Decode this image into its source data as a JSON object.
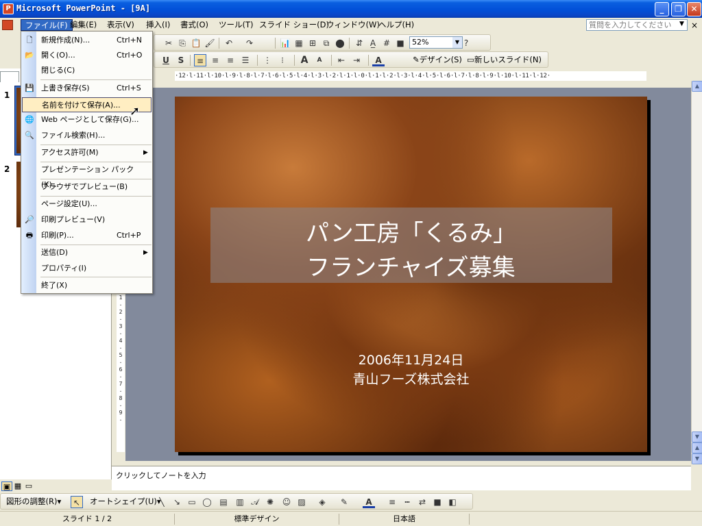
{
  "window": {
    "title": "Microsoft PowerPoint - [9A]",
    "app_icon_letter": "P",
    "minimize_glyph": "_",
    "restore_glyph": "❐",
    "close_glyph": "✕"
  },
  "menubar": {
    "items": [
      "ファイル(F)",
      "編集(E)",
      "表示(V)",
      "挿入(I)",
      "書式(O)",
      "ツール(T)",
      "スライド ショー(D)",
      "ウィンドウ(W)",
      "ヘルプ(H)"
    ],
    "active_index": 0,
    "ask_placeholder": "質問を入力してください",
    "ask_dropdown": "▼",
    "close_glyph": "×"
  },
  "toolbar": {
    "zoom": "52%",
    "zoom_dropdown": "▼",
    "design_label": "デザイン(S)",
    "new_slide_label": "新しいスライド(N)",
    "bold_glyph": "U",
    "shadow_glyph": "S",
    "font_grow": "A",
    "font_shrink": "A",
    "font_color": "A",
    "help_glyph": "?"
  },
  "file_menu": {
    "items": [
      {
        "label": "新規作成(N)...",
        "shortcut": "Ctrl+N",
        "icon": "new-doc-icon",
        "glyph": "🗋"
      },
      {
        "label": "開く(O)...",
        "shortcut": "Ctrl+O",
        "icon": "open-folder-icon",
        "glyph": "📂"
      },
      {
        "label": "閉じる(C)",
        "shortcut": "",
        "icon": "",
        "glyph": ""
      },
      {
        "label": "上書き保存(S)",
        "shortcut": "Ctrl+S",
        "icon": "save-icon",
        "glyph": "💾"
      },
      {
        "label": "名前を付けて保存(A)...",
        "shortcut": "",
        "icon": "",
        "glyph": ""
      },
      {
        "label": "Web ページとして保存(G)...",
        "shortcut": "",
        "icon": "web-save-icon",
        "glyph": "🌐"
      },
      {
        "label": "ファイル検索(H)...",
        "shortcut": "",
        "icon": "file-search-icon",
        "glyph": "🔍"
      },
      {
        "label": "アクセス許可(M)",
        "shortcut": "",
        "icon": "",
        "glyph": ""
      },
      {
        "label": "プレゼンテーション パック(K)...",
        "shortcut": "",
        "icon": "",
        "glyph": ""
      },
      {
        "label": "ブラウザでプレビュー(B)",
        "shortcut": "",
        "icon": "",
        "glyph": ""
      },
      {
        "label": "ページ設定(U)...",
        "shortcut": "",
        "icon": "",
        "glyph": ""
      },
      {
        "label": "印刷プレビュー(V)",
        "shortcut": "",
        "icon": "print-preview-icon",
        "glyph": "🔎"
      },
      {
        "label": "印刷(P)...",
        "shortcut": "Ctrl+P",
        "icon": "print-icon",
        "glyph": "🖶"
      },
      {
        "label": "送信(D)",
        "shortcut": "",
        "icon": "",
        "glyph": ""
      },
      {
        "label": "プロパティ(I)",
        "shortcut": "",
        "icon": "",
        "glyph": ""
      },
      {
        "label": "終了(X)",
        "shortcut": "",
        "icon": "",
        "glyph": ""
      }
    ],
    "submenu_arrow": "▶",
    "hover_index": 4
  },
  "slides_panel": {
    "slide_numbers": [
      "1",
      "2"
    ],
    "selected": 0
  },
  "slide": {
    "title_line1": "パン工房「くるみ」",
    "title_line2": "フランチャイズ募集",
    "date": "2006年11月24日",
    "company": "青山フーズ株式会社"
  },
  "ruler": {
    "horizontal": "·12·l·11·l·10·l·9·l·8·l·7·l·6·l·5·l·4·l·3·l·2·l·1·l·0·l·1·l·2·l·3·l·4·l·5·l·6·l·7·l·8·l·9·l·10·l·11·l·12·",
    "vertical": [
      "1",
      "·",
      "2",
      "·",
      "3",
      "·",
      "4",
      "·",
      "5",
      "·",
      "6",
      "·",
      "7",
      "·",
      "8",
      "·",
      "9",
      "·"
    ]
  },
  "notes_placeholder": "クリックしてノートを入力",
  "drawing_toolbar": {
    "draw_label": "図形の調整(R)",
    "autoshape_label": "オートシェイプ(U)",
    "dropdown_glyph": "▾"
  },
  "statusbar": {
    "slide": "スライド 1 / 2",
    "design": "標準デザイン",
    "language": "日本語"
  },
  "scrollbar": {
    "up": "▲",
    "down": "▼",
    "prev": "▲",
    "next": "▼"
  },
  "viewbar": {
    "normal": "▣",
    "sorter": "▦",
    "show": "▭"
  }
}
